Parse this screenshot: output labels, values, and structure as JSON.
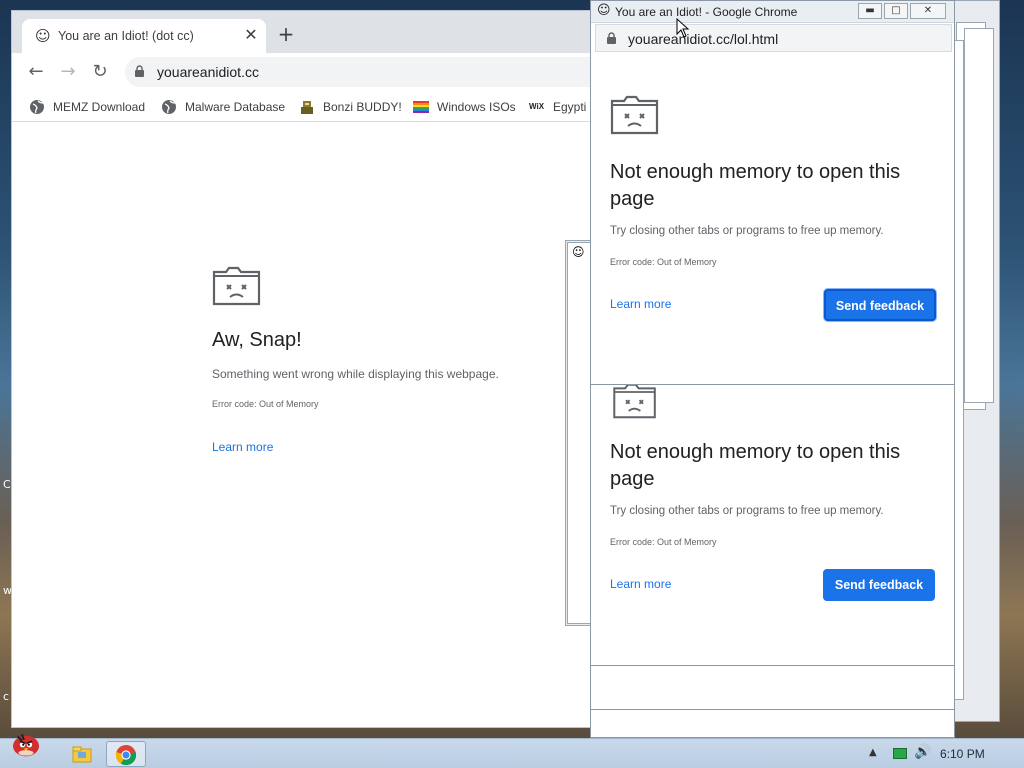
{
  "desktop": {
    "edge_text_1": "C",
    "edge_text_2": "w",
    "edge_text_3": "c"
  },
  "main_window": {
    "tab_title": "You are an Idiot! (dot cc)",
    "tab_favicon": "smiley-icon",
    "url": "youareanidiot.cc",
    "bookmarks": [
      {
        "label": "MEMZ Download",
        "icon": "globe-icon"
      },
      {
        "label": "Malware Database",
        "icon": "globe-icon"
      },
      {
        "label": "Bonzi BUDDY!",
        "icon": "bonzi-icon"
      },
      {
        "label": "Windows ISOs",
        "icon": "windows-flag-icon"
      },
      {
        "label": "Egypti",
        "icon": "wix-icon"
      }
    ],
    "error": {
      "title": "Aw, Snap!",
      "message": "Something went wrong while displaying this webpage.",
      "code": "Error code: Out of Memory",
      "learn_more": "Learn more"
    }
  },
  "popup_front": {
    "window_title": "You are an Idiot! - Google Chrome",
    "url": "youareanidiot.cc/lol.html",
    "title": "Not enough memory to open this page",
    "message": "Try closing other tabs or programs to free up memory.",
    "code": "Error code: Out of Memory",
    "learn_more": "Learn more",
    "feedback": "Send feedback"
  },
  "popup_back": {
    "title": "Not enough memory to open this page",
    "message": "Try closing other tabs or programs to free up memory.",
    "code": "Error code: Out of Memory",
    "learn_more": "Learn more",
    "feedback": "Send feedback"
  },
  "taskbar": {
    "clock": "6:10 PM"
  },
  "colors": {
    "accent": "#1a73e8",
    "tab_strip": "#dee1e6",
    "taskbar": "#c9d9ea"
  }
}
